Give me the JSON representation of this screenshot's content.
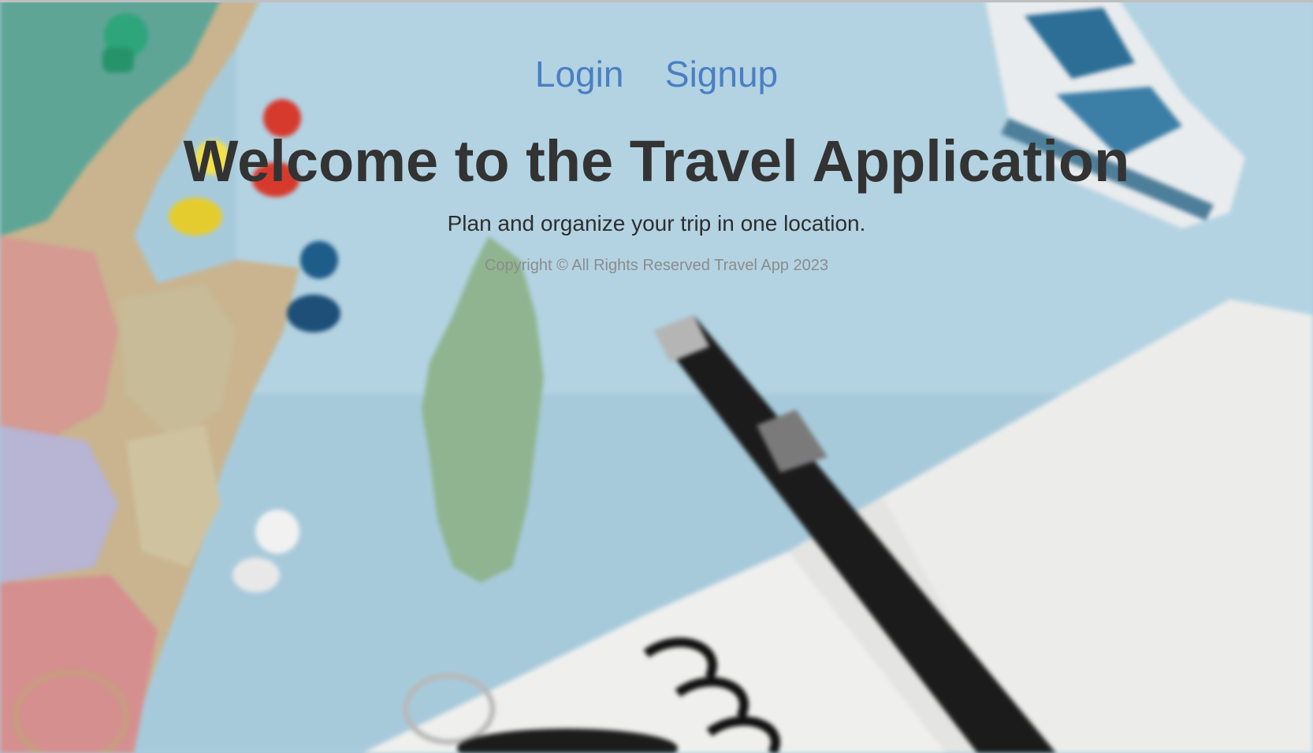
{
  "nav": {
    "login_label": "Login",
    "signup_label": "Signup"
  },
  "hero": {
    "title": "Welcome to the Travel Application",
    "subtitle": "Plan and organize your trip in one location.",
    "copyright": "Copyright © All Rights Reserved Travel App 2023"
  },
  "colors": {
    "link": "#4a7fc4",
    "title": "#333333",
    "subtitle": "#2e2e2e",
    "copyright": "#8c8c8c",
    "map_water": "#a9cbdc"
  },
  "background": {
    "icon": "travel-map-with-pins-pen-notebook-icon"
  }
}
